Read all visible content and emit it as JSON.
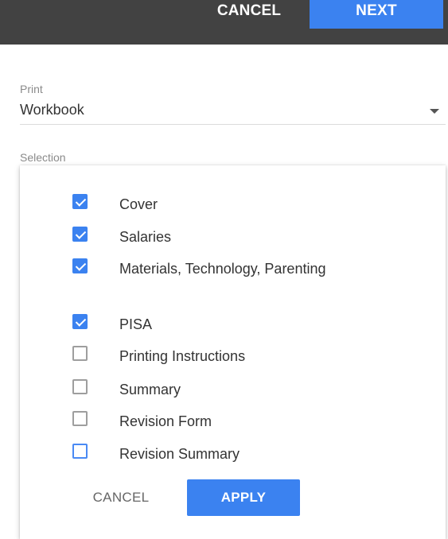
{
  "header": {
    "cancel_label": "CANCEL",
    "next_label": "NEXT"
  },
  "print": {
    "label": "Print",
    "value": "Workbook"
  },
  "selection": {
    "label": "Selection",
    "options": [
      {
        "label": "Cover",
        "checked": true
      },
      {
        "label": "Salaries",
        "checked": true
      },
      {
        "label": "Materials, Technology, Parenting",
        "checked": true
      },
      {
        "label": "PISA",
        "checked": true
      },
      {
        "label": "Printing Instructions",
        "checked": false
      },
      {
        "label": "Summary",
        "checked": false
      },
      {
        "label": "Revision Form",
        "checked": false
      },
      {
        "label": "Revision Summary",
        "checked": false
      }
    ],
    "cancel_label": "CANCEL",
    "apply_label": "APPLY"
  },
  "colors": {
    "accent": "#3b82f0",
    "topbar": "#424242"
  }
}
